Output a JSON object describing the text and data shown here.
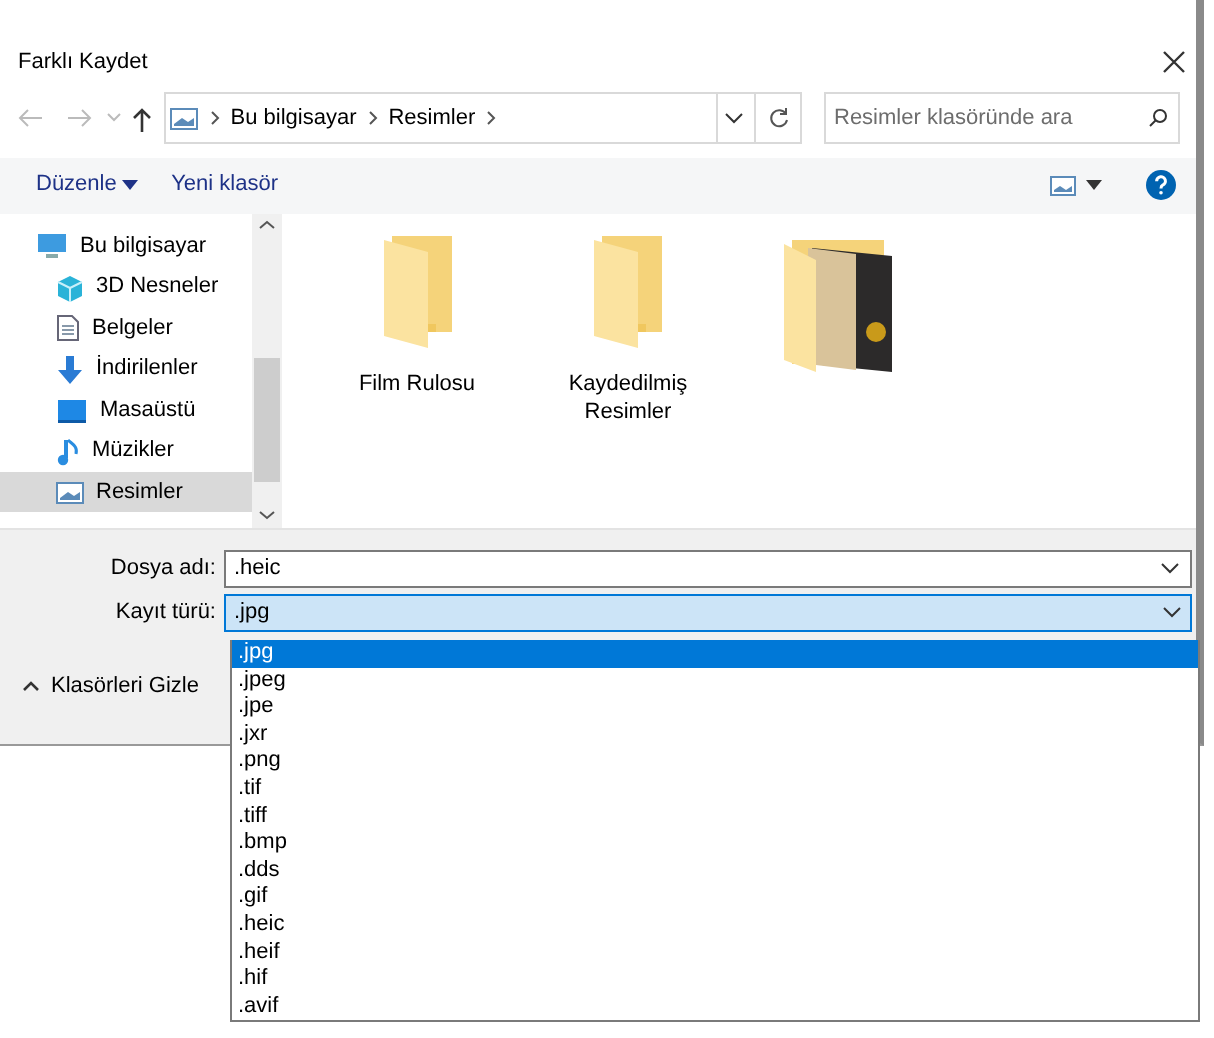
{
  "window": {
    "title": "Farklı Kaydet"
  },
  "address_bar": {
    "path": [
      "Bu bilgisayar",
      "Resimler"
    ]
  },
  "search": {
    "placeholder": "Resimler klasöründe ara"
  },
  "toolbar": {
    "organize": "Düzenle",
    "new_folder": "Yeni klasör"
  },
  "sidebar": {
    "items": [
      {
        "label": "Bu bilgisayar",
        "selected": false,
        "children": [
          {
            "label": "3D Nesneler",
            "selected": false
          },
          {
            "label": "Belgeler",
            "selected": false
          },
          {
            "label": "İndirilenler",
            "selected": false
          },
          {
            "label": "Masaüstü",
            "selected": false
          },
          {
            "label": "Müzikler",
            "selected": false
          },
          {
            "label": "Resimler",
            "selected": true
          }
        ]
      }
    ]
  },
  "folders": [
    {
      "name": "Film Rulosu",
      "kind": "plain"
    },
    {
      "name": "Kaydedilmiş Resimler",
      "kind": "plain"
    },
    {
      "kind": "pictures"
    }
  ],
  "file_name": {
    "label": "Dosya adı:",
    "value": ".heic"
  },
  "file_type": {
    "label": "Kayıt türü:",
    "value": ".jpg",
    "expanded": true,
    "options": [
      {
        "label": ".jpg",
        "selected": true
      },
      {
        "label": ".jpeg",
        "selected": false
      },
      {
        "label": ".jpe",
        "selected": false
      },
      {
        "label": ".jxr",
        "selected": false
      },
      {
        "label": ".png",
        "selected": false
      },
      {
        "label": ".tif",
        "selected": false
      },
      {
        "label": ".tiff",
        "selected": false
      },
      {
        "label": ".bmp",
        "selected": false
      },
      {
        "label": ".dds",
        "selected": false
      },
      {
        "label": ".gif",
        "selected": false
      },
      {
        "label": ".heic",
        "selected": false
      },
      {
        "label": ".heif",
        "selected": false
      },
      {
        "label": ".hif",
        "selected": false
      },
      {
        "label": ".avif",
        "selected": false
      }
    ]
  },
  "hide_folders": "Klasörleri Gizle"
}
